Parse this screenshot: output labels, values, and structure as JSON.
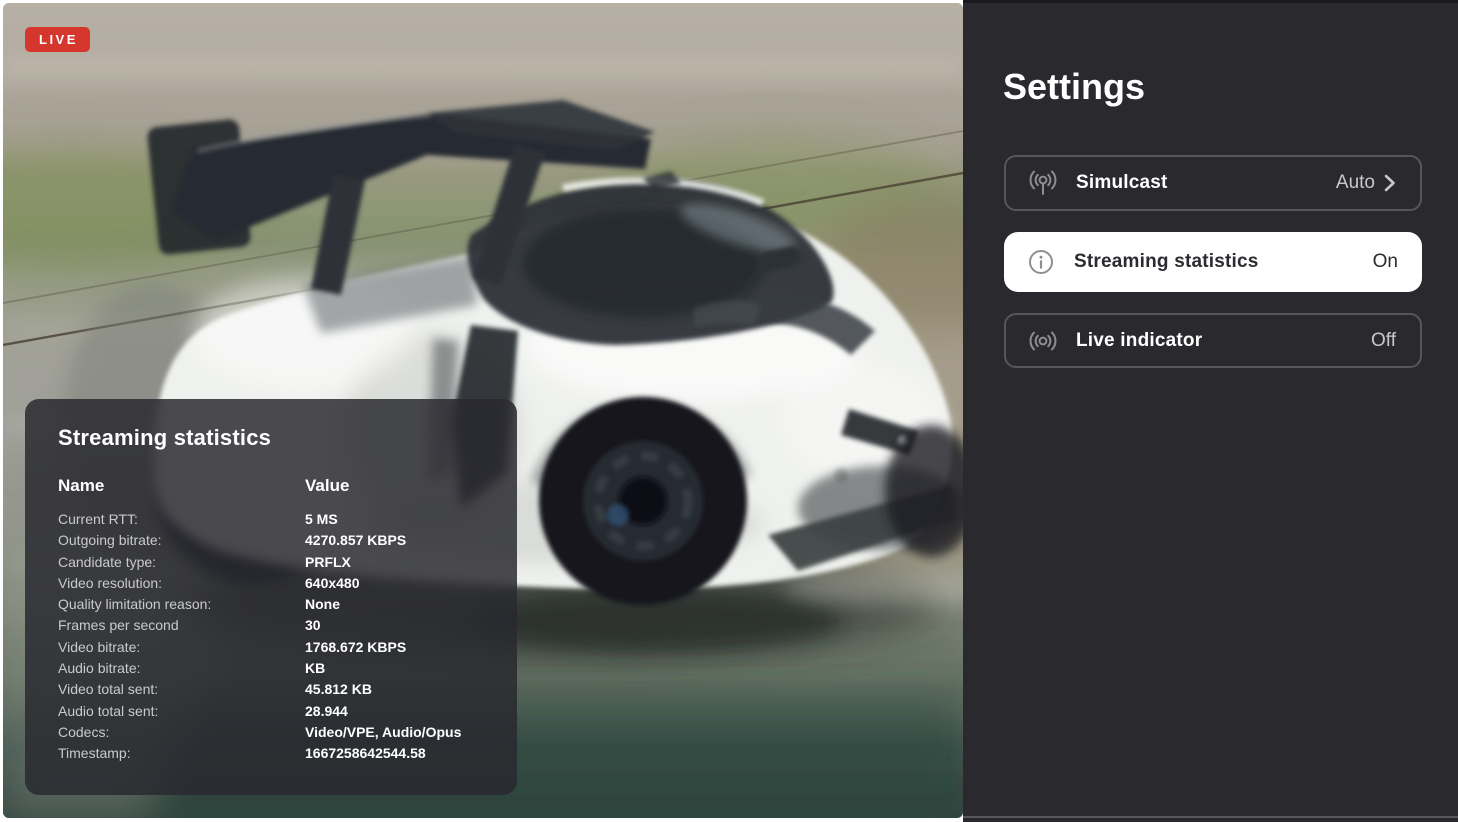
{
  "live_badge": {
    "label": "LIVE"
  },
  "video": {
    "subject": "Blurred live camera frame of a white McLaren supercar with a large rear wing cornering on a race track"
  },
  "stats_panel": {
    "title": "Streaming statistics",
    "columns": {
      "name": "Name",
      "value": "Value"
    },
    "rows": [
      {
        "label": "Current RTT:",
        "value": "5 MS"
      },
      {
        "label": "Outgoing bitrate:",
        "value": "4270.857 KBPS"
      },
      {
        "label": "Candidate type:",
        "value": "PRFLX"
      },
      {
        "label": "Video resolution:",
        "value": "640x480"
      },
      {
        "label": "Quality limitation reason:",
        "value": "None"
      },
      {
        "label": "Frames per second",
        "value": "30"
      },
      {
        "label": "Video bitrate:",
        "value": "1768.672 KBPS"
      },
      {
        "label": "Audio bitrate:",
        "value": "KB"
      },
      {
        "label": "Video total sent:",
        "value": "45.812 KB"
      },
      {
        "label": "Audio total sent:",
        "value": "28.944"
      },
      {
        "label": "Codecs:",
        "value": "Video/VPE, Audio/Opus"
      },
      {
        "label": "Timestamp:",
        "value": "1667258642544.58"
      }
    ]
  },
  "settings": {
    "title": "Settings",
    "items": [
      {
        "label": "Simulcast",
        "value": "Auto",
        "icon": "broadcast-icon",
        "has_chevron": true,
        "selected": false
      },
      {
        "label": "Streaming statistics",
        "value": "On",
        "icon": "info-icon",
        "has_chevron": false,
        "selected": true
      },
      {
        "label": "Live indicator",
        "value": "Off",
        "icon": "live-signal-icon",
        "has_chevron": false,
        "selected": false
      }
    ]
  },
  "colors": {
    "live_red": "#D5362E",
    "sidebar_bg": "#29292E",
    "row_border": "#56565C",
    "selected_row_bg": "#FFFFFF",
    "text_primary": "#FFFFFF",
    "text_secondary": "#C7C7CC",
    "text_dark": "#2B2B31",
    "icon_gray": "#8E8E93",
    "stats_panel_bg": "rgba(40,40,46,0.84)"
  }
}
